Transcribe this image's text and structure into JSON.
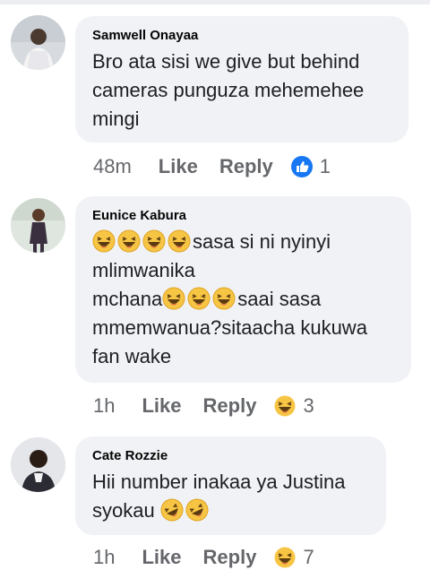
{
  "comments": [
    {
      "author": "Samwell Onayaa",
      "lines": [
        "Bro ata sisi we give but behind",
        "cameras punguza mehemehee",
        "mingi"
      ],
      "time": "48m",
      "like_label": "Like",
      "reply_label": "Reply",
      "reaction_icon": "like-reaction-icon",
      "reaction_count": "1"
    },
    {
      "author": "Eunice Kabura",
      "lines": [
        "sasa si ni nyinyi",
        "mlimwanika",
        "mchana",
        "saai sasa",
        "mmemwanua?sitaacha kukuwa",
        "fan wake"
      ],
      "time": "1h",
      "like_label": "Like",
      "reply_label": "Reply",
      "reaction_icon": "haha-reaction-icon",
      "reaction_count": "3"
    },
    {
      "author": "Cate  Rozzie",
      "lines": [
        "Hii number inakaa ya Justina",
        "syokau"
      ],
      "time": "1h",
      "like_label": "Like",
      "reply_label": "Reply",
      "reaction_icon": "haha-reaction-icon",
      "reaction_count": "7"
    }
  ],
  "colors": {
    "bubble": "#f0f2f5",
    "meta_text": "#65676b",
    "like_blue": "#1877f2",
    "haha_yellow": "#f7c544"
  }
}
